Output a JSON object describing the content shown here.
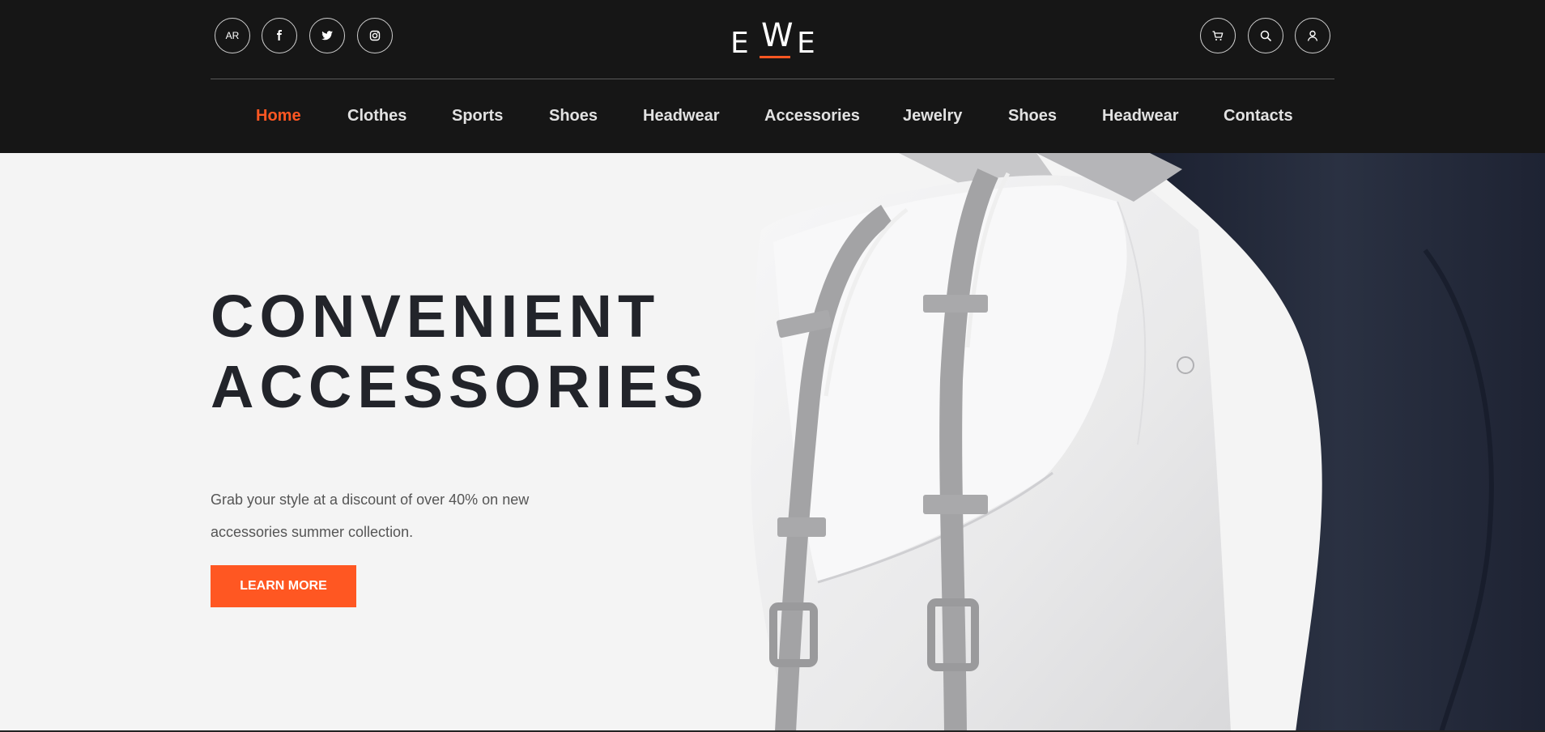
{
  "header": {
    "language_label": "AR",
    "social": [
      {
        "icon": "facebook-icon"
      },
      {
        "icon": "twitter-icon"
      },
      {
        "icon": "instagram-icon"
      }
    ],
    "logo": {
      "left": "E",
      "center": "W",
      "right": "E"
    },
    "actions": [
      {
        "icon": "cart-icon"
      },
      {
        "icon": "search-icon"
      },
      {
        "icon": "user-icon"
      }
    ]
  },
  "nav": {
    "items": [
      {
        "label": "Home",
        "active": true
      },
      {
        "label": "Clothes"
      },
      {
        "label": "Sports"
      },
      {
        "label": "Shoes"
      },
      {
        "label": "Headwear"
      },
      {
        "label": "Accessories"
      },
      {
        "label": "Jewelry"
      },
      {
        "label": "Shoes"
      },
      {
        "label": "Headwear"
      },
      {
        "label": "Contacts"
      }
    ]
  },
  "hero": {
    "title_line1": "CONVENIENT",
    "title_line2": "ACCESSORIES",
    "subtitle_line1": "Grab your style at a discount of over 40% on new",
    "subtitle_line2": "accessories summer collection.",
    "cta_label": "LEARN MORE"
  },
  "colors": {
    "accent": "#ff5722",
    "header_bg": "#161616",
    "hero_bg": "#f4f4f4",
    "title_text": "#22242a"
  }
}
